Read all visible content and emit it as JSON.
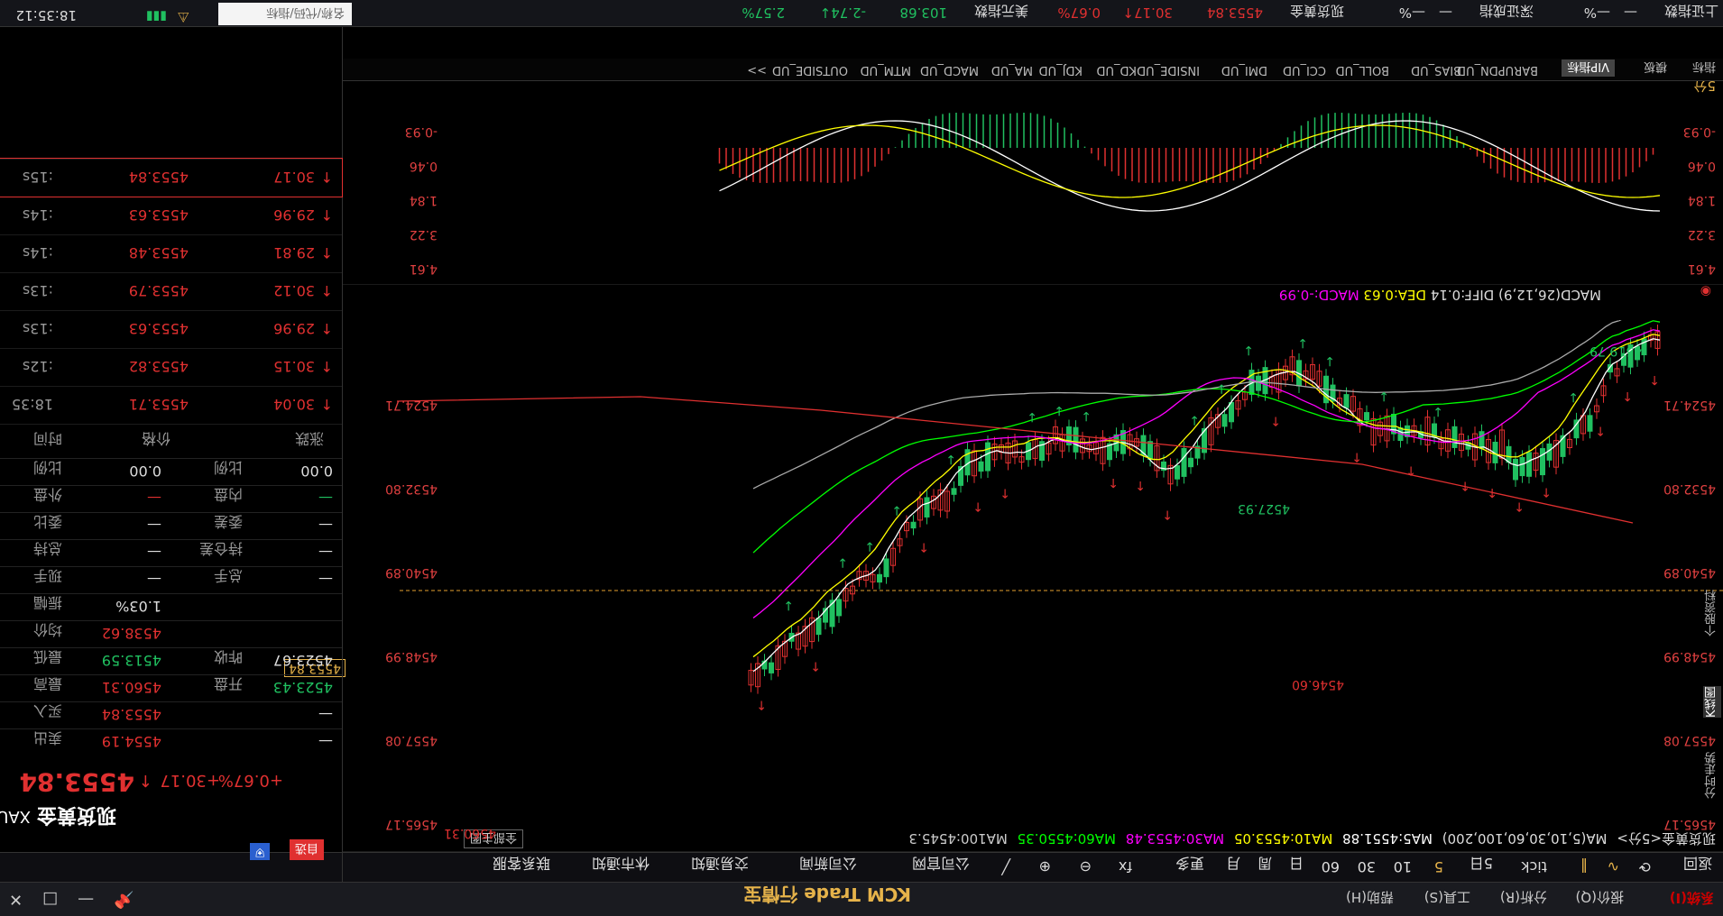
{
  "app": {
    "title": "KCM Trade 行情宝",
    "logo": "KCM"
  },
  "menu": [
    "系统(I)",
    "报价(Q)",
    "分析(R)",
    "工具(S)",
    "帮助(H)"
  ],
  "window": {
    "pin": "📌",
    "min": "—",
    "max": "□",
    "close": "✕"
  },
  "toolbar": {
    "back": "返回",
    "refresh": "⟳",
    "periods": [
      "tick",
      "5日",
      "5",
      "10",
      "30",
      "60",
      "日",
      "周",
      "月"
    ],
    "more": "更多",
    "fx": "fx",
    "customer_service": "联系客服",
    "trade_notice": "交易通知",
    "market_news": "休市通知",
    "company_news": "公司新闻",
    "company_site": "公司官网",
    "selected_period": "5"
  },
  "chart": {
    "name": "现货黄金<5分>",
    "ma_labels": [
      {
        "text": "MA5:4551.88",
        "color": "#ffffff"
      },
      {
        "text": "MA10:4553.05",
        "color": "#ffff00"
      },
      {
        "text": "MA30:4553.48",
        "color": "#ff00ff"
      },
      {
        "text": "MA60:4550.35",
        "color": "#00ff00"
      },
      {
        "text": "MA100:4545.3",
        "color": "#cccccc"
      }
    ],
    "ma_params": "MA(5,10,30,60,100,200)",
    "all_main": "全部主图",
    "y_ticks": [
      "4524.71",
      "4532.80",
      "4540.89",
      "4548.99",
      "4557.08",
      "4565.17"
    ],
    "high_label": "4519.79",
    "low_label": "4560.31",
    "mid_high": "4527.93",
    "mid_low": "4546.60",
    "current_price": "4553.84"
  },
  "indicator": {
    "text": "MACD(26,12,9)",
    "diff": "DIFF:0.14",
    "dea": "DEA:0.63",
    "macd": "MACD:-0.99",
    "y_ticks": [
      "-0.93",
      "0.46",
      "1.84",
      "3.22",
      "4.61"
    ],
    "period": "5分"
  },
  "tabs": [
    "指标",
    "模板",
    "VIP指标",
    "BARUPDN_UD",
    "BIAS_UD",
    "BOLL_UD",
    "CCI_UD",
    "DMI_UD",
    "INSIDE_UD",
    "KD_UD",
    "KDJ_UD",
    "MA_UD",
    "MACD_UD",
    "MTM_UD",
    "OUTSIDE_UD",
    ">>"
  ],
  "quote": {
    "code": "XAU",
    "name": "现货黄金",
    "price": "4553.84",
    "arrow": "↑",
    "change": "+30.17",
    "pct": "+0.67%",
    "btn_self": "自选",
    "rows": [
      {
        "label": "卖出",
        "val": "4554.19",
        "val_class": "red",
        "label2": "",
        "val2": "—"
      },
      {
        "label": "买入",
        "val": "4553.84",
        "val_class": "red",
        "label2": "",
        "val2": "—"
      },
      {
        "label": "最高",
        "val": "4560.31",
        "val_class": "red",
        "label2": "开盘",
        "val2": "4523.43",
        "val2_class": "grn"
      },
      {
        "label": "最低",
        "val": "4513.59",
        "val_class": "grn",
        "label2": "昨收",
        "val2": "4523.67",
        "val2_class": "wht"
      },
      {
        "label": "均价",
        "val": "4538.62",
        "val_class": "red",
        "label2": "",
        "val2": ""
      },
      {
        "label": "振幅",
        "val": "1.03%",
        "val_class": "wht",
        "label2": "",
        "val2": ""
      },
      {
        "label": "现手",
        "val": "—",
        "val_class": "wht",
        "label2": "总手",
        "val2": "—"
      },
      {
        "label": "总持",
        "val": "—",
        "val_class": "wht",
        "label2": "持仓差",
        "val2": "—"
      },
      {
        "label": "委比",
        "val": "—",
        "val_class": "wht",
        "label2": "委差",
        "val2": "—"
      },
      {
        "label": "外盘",
        "val": "—",
        "val_class": "red",
        "label2": "内盘",
        "val2": "—",
        "val2_class": "grn"
      },
      {
        "label": "比例",
        "val": "0.00",
        "val_class": "wht",
        "label2": "比例",
        "val2": "0.00"
      }
    ],
    "tick_header": [
      "时间",
      "价格",
      "涨跌"
    ],
    "ticks": [
      {
        "t": "18:35",
        "p": "4553.71",
        "c": "30.04"
      },
      {
        "t": ":12s",
        "p": "4553.82",
        "c": "30.15"
      },
      {
        "t": ":13s",
        "p": "4553.63",
        "c": "29.96"
      },
      {
        "t": ":13s",
        "p": "4553.79",
        "c": "30.12"
      },
      {
        "t": ":14s",
        "p": "4553.48",
        "c": "29.81"
      },
      {
        "t": ":14s",
        "p": "4553.63",
        "c": "29.96"
      },
      {
        "t": ":15s",
        "p": "4553.84",
        "c": "30.17"
      }
    ],
    "side_tabs": [
      "分时走势",
      "K线图",
      "个股资料"
    ],
    "extra": "盘"
  },
  "status": {
    "items": [
      "上证指数",
      "—",
      "—%",
      "深证成指",
      "—",
      "—%",
      "现货黄金",
      "4553.84",
      "30.17↑",
      "0.67%",
      "美元指数",
      "103.68",
      "-2.74↓",
      "2.57%"
    ],
    "search": "名称/代码/指标",
    "time": "18:35:12"
  }
}
